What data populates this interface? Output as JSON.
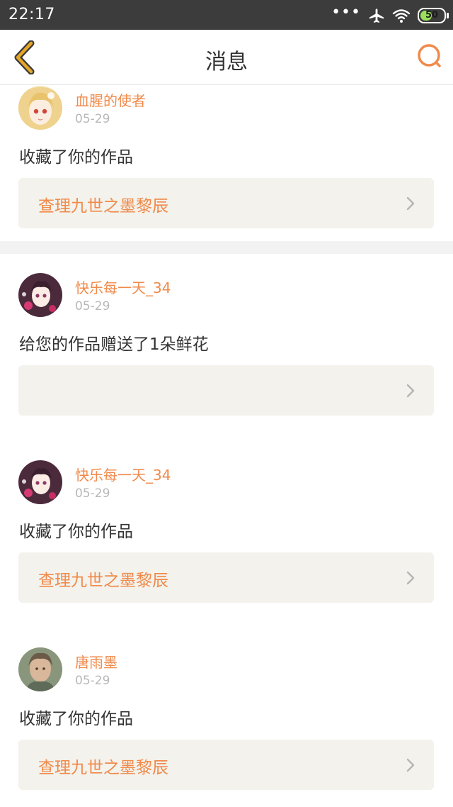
{
  "status_bar": {
    "time": "22:17",
    "battery_level": "50"
  },
  "header": {
    "title": "消息"
  },
  "messages": [
    {
      "user": "血腥的使者",
      "date": "05-29",
      "text": "收藏了你的作品",
      "work": "查理九世之墨黎辰",
      "avatar": "avatar-anime-blonde-girl"
    },
    {
      "user": "快乐每一天_34",
      "date": "05-29",
      "text": "给您的作品赠送了1朵鲜花",
      "work": "",
      "avatar": "avatar-anime-dark-hair-girl"
    },
    {
      "user": "快乐每一天_34",
      "date": "05-29",
      "text": "收藏了你的作品",
      "work": "查理九世之墨黎辰",
      "avatar": "avatar-anime-dark-hair-girl"
    },
    {
      "user": "唐雨墨",
      "date": "05-29",
      "text": "收藏了你的作品",
      "work": "查理九世之墨黎辰",
      "avatar": "avatar-portrait-painting"
    }
  ],
  "colors": {
    "accent": "#f08a4b",
    "back_arrow": "#e6a625",
    "status_bar_bg": "#3c3c3c",
    "work_box_bg": "#f3f2ec",
    "page_bg": "#f2f2f2",
    "date_text": "#b8b8b8",
    "body_text": "#333333"
  },
  "icons": {
    "back": "back-arrow-icon",
    "search": "search-icon",
    "chevron": "chevron-right-icon",
    "wifi": "wifi-icon",
    "airplane": "airplane-icon",
    "more": "more-dots-icon",
    "battery": "battery-icon"
  }
}
